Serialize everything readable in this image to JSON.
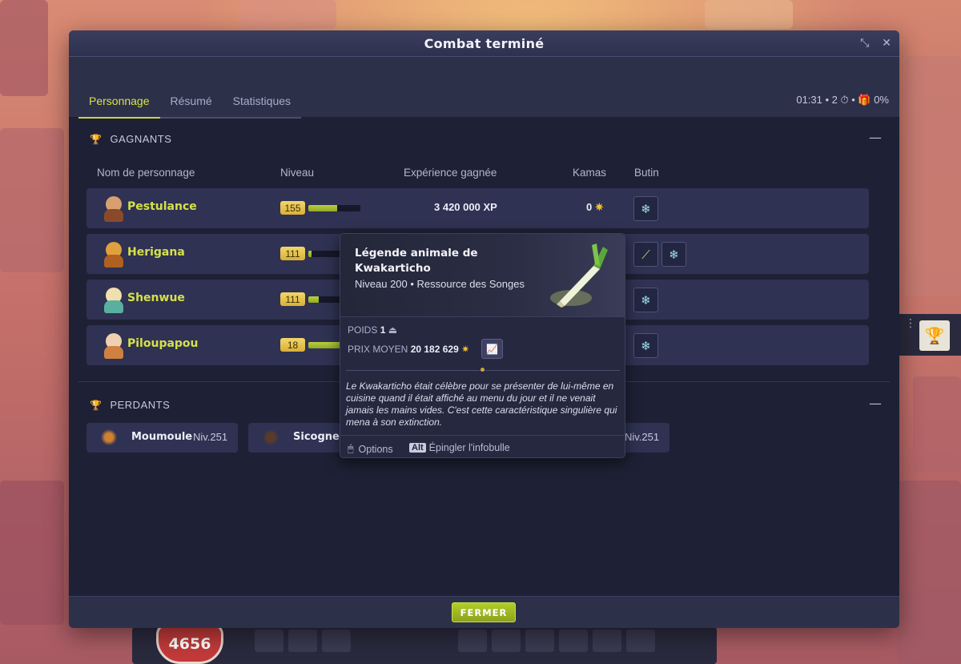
{
  "modal": {
    "title": "Combat terminé",
    "tabs": [
      {
        "label": "Personnage"
      },
      {
        "label": "Résumé"
      },
      {
        "label": "Statistiques"
      }
    ],
    "combat_meta": "01:31 • 2 ⏱ • 🎁 0%",
    "close_button": "FERMER"
  },
  "winners": {
    "title": "GAGNANTS",
    "columns": {
      "name": "Nom de personnage",
      "level": "Niveau",
      "xp": "Expérience gagnée",
      "kamas": "Kamas",
      "loot": "Butin"
    },
    "rows": [
      {
        "name": "Pestulance",
        "level": "155",
        "xp_progress": 0.55,
        "xp": "3 420 000 XP",
        "kamas": "0"
      },
      {
        "name": "Herigana",
        "level": "111",
        "xp_progress": 0.06
      },
      {
        "name": "Shenwue",
        "level": "111",
        "xp_progress": 0.2
      },
      {
        "name": "Piloupapou",
        "level": "18",
        "xp_progress": 1.0
      }
    ]
  },
  "losers": {
    "title": "PERDANTS",
    "items": [
      {
        "name": "Moumoule",
        "level": "Niv.251"
      },
      {
        "name": "Sicogne"
      },
      {
        "level": "Niv.251"
      }
    ]
  },
  "tooltip": {
    "name": "Légende animale de Kwakarticho",
    "subtitle": "Niveau 200  •  Ressource des Songes",
    "weight_label": "POIDS",
    "weight_value": "1",
    "price_label": "PRIX MOYEN",
    "price_value": "20 182 629",
    "description": "Le Kwakarticho était célèbre pour se présenter de lui-même en cuisine quand il était affiché au menu du jour et il ne venait jamais les mains vides. C'est cette caractéristique singulière qui mena à son extinction.",
    "options_label": "Options",
    "alt_key": "Alt",
    "pin_label": "Épingler l'infobulle"
  },
  "hud": {
    "hp": "4656"
  },
  "colors": {
    "accent_green": "#c9d63a",
    "name_yellow": "#d5e14a",
    "modal_bg": "#1e2035",
    "row_bg": "#2f3252"
  }
}
